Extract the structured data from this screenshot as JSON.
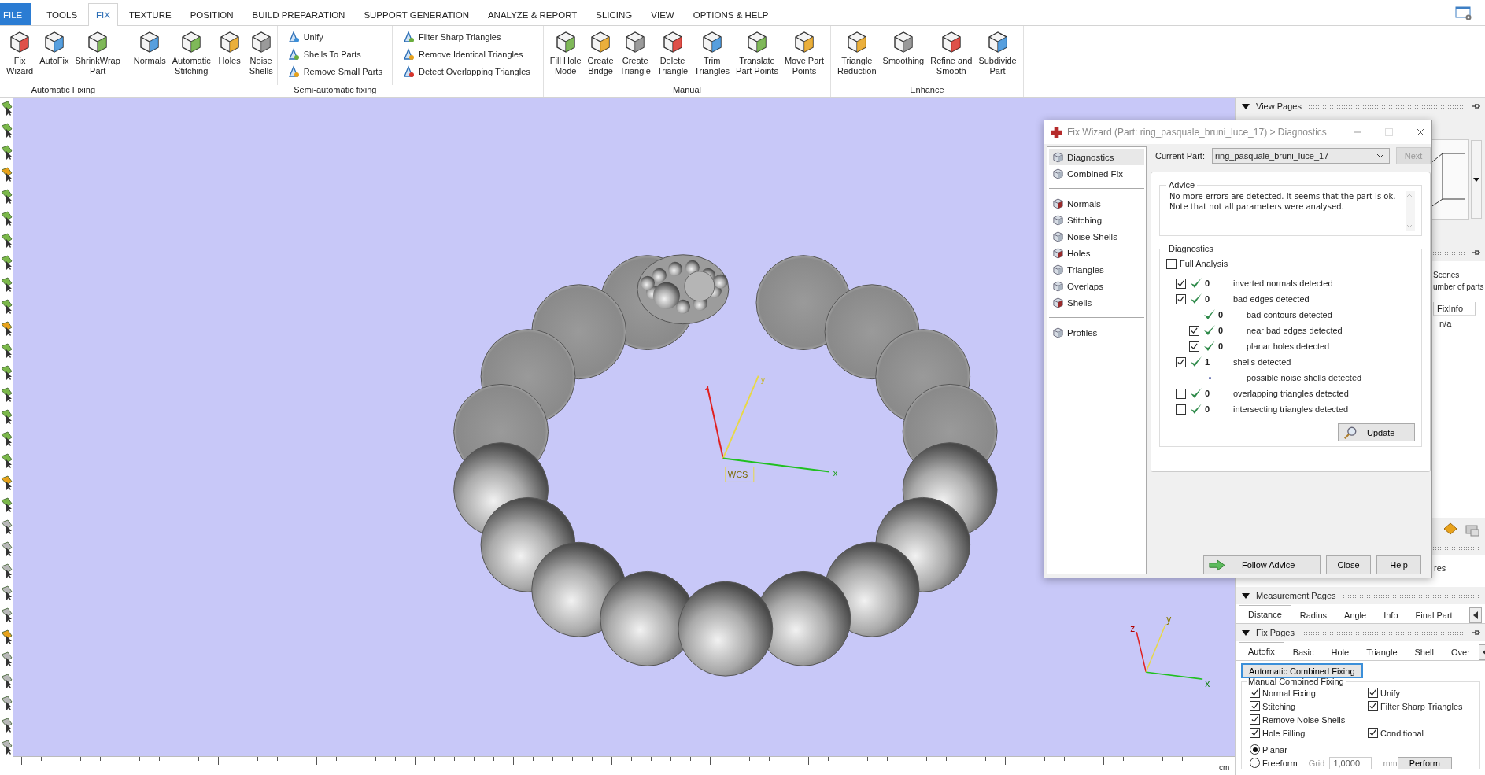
{
  "tabs": [
    {
      "label": "FILE",
      "kind": "file",
      "selected": false
    },
    {
      "label": "TOOLS",
      "kind": "tab",
      "selected": false
    },
    {
      "label": "FIX",
      "kind": "tab",
      "selected": true
    },
    {
      "label": "TEXTURE",
      "kind": "tab",
      "selected": false
    },
    {
      "label": "POSITION",
      "kind": "tab",
      "selected": false
    },
    {
      "label": "BUILD PREPARATION",
      "kind": "tab",
      "selected": false
    },
    {
      "label": "SUPPORT GENERATION",
      "kind": "tab",
      "selected": false
    },
    {
      "label": "ANALYZE & REPORT",
      "kind": "tab",
      "selected": false
    },
    {
      "label": "SLICING",
      "kind": "tab",
      "selected": false
    },
    {
      "label": "VIEW",
      "kind": "tab",
      "selected": false
    },
    {
      "label": "OPTIONS & HELP",
      "kind": "tab",
      "selected": false
    }
  ],
  "ribbon": {
    "groups": [
      {
        "label": "Automatic Fixing",
        "sections": [
          {
            "kind": "large",
            "items": [
              "Fix\nWizard",
              "AutoFix",
              "ShrinkWrap\nPart"
            ]
          }
        ]
      },
      {
        "label": "Semi-automatic fixing",
        "sections": [
          {
            "kind": "large",
            "items": [
              "Normals",
              "Automatic\nStitching",
              "Holes",
              "Noise\nShells"
            ]
          },
          {
            "kind": "small",
            "items": [
              "Unify",
              "Shells To Parts",
              "Remove Small Parts"
            ]
          },
          {
            "kind": "small",
            "items": [
              "Filter Sharp Triangles",
              "Remove Identical Triangles",
              "Detect Overlapping Triangles"
            ]
          }
        ]
      },
      {
        "label": "Manual",
        "sections": [
          {
            "kind": "large",
            "items": [
              "Fill Hole\nMode",
              "Create\nBridge",
              "Create\nTriangle",
              "Delete\nTriangle",
              "Trim\nTriangles",
              "Translate\nPart Points",
              "Move Part\nPoints"
            ]
          }
        ]
      },
      {
        "label": "Enhance",
        "sections": [
          {
            "kind": "large",
            "items": [
              "Triangle\nReduction",
              "Smoothing",
              "Refine and\nSmooth",
              "Subdivide\nPart"
            ]
          }
        ]
      }
    ]
  },
  "viewport": {
    "axes": {
      "z": "z",
      "y": "y",
      "x": "x",
      "origin": "WCS"
    },
    "mini_axes": {
      "z": "z",
      "y": "y",
      "x": "x"
    },
    "ruler_unit": "cm"
  },
  "dialog": {
    "title": "Fix Wizard (Part: ring_pasquale_bruni_luce_17) > Diagnostics",
    "nav_groups": [
      [
        {
          "label": "Diagnostics",
          "selected": true
        },
        {
          "label": "Combined Fix",
          "selected": false
        }
      ],
      [
        {
          "label": "Normals",
          "selected": false
        },
        {
          "label": "Stitching",
          "selected": false
        },
        {
          "label": "Noise Shells",
          "selected": false
        },
        {
          "label": "Holes",
          "selected": false
        },
        {
          "label": "Triangles",
          "selected": false
        },
        {
          "label": "Overlaps",
          "selected": false
        },
        {
          "label": "Shells",
          "selected": false
        }
      ],
      [
        {
          "label": "Profiles",
          "selected": false
        }
      ]
    ],
    "current_part": {
      "label": "Current Part:",
      "value": "ring_pasquale_bruni_luce_17"
    },
    "next": {
      "label": "Next",
      "disabled": true
    },
    "advice": {
      "title": "Advice",
      "lines": [
        "No more errors are detected. It seems that the part is ok.",
        "Note that not all parameters were analysed."
      ]
    },
    "diagnostics": {
      "title": "Diagnostics",
      "full_analysis": {
        "label": "Full Analysis",
        "checked": false
      },
      "rows": [
        {
          "kind": "check",
          "checked": true,
          "passed": true,
          "count": "0",
          "label": "inverted normals detected"
        },
        {
          "kind": "check",
          "checked": true,
          "passed": true,
          "count": "0",
          "label": "bad edges detected",
          "children": [
            {
              "kind": "plain",
              "passed": true,
              "count": "0",
              "label": "bad contours detected"
            },
            {
              "kind": "check",
              "checked": true,
              "passed": true,
              "count": "0",
              "label": "near bad edges detected"
            },
            {
              "kind": "check",
              "checked": true,
              "passed": true,
              "count": "0",
              "label": "planar holes detected"
            }
          ]
        },
        {
          "kind": "check",
          "checked": true,
          "passed": true,
          "count": "1",
          "label": "shells detected",
          "children": [
            {
              "kind": "plain",
              "passed": false,
              "label": "possible noise shells detected"
            }
          ]
        },
        {
          "kind": "check",
          "checked": false,
          "passed": true,
          "count": "0",
          "label": "overlapping triangles detected"
        },
        {
          "kind": "check",
          "checked": false,
          "passed": true,
          "count": "0",
          "label": "intersecting triangles detected"
        }
      ],
      "update": "Update"
    },
    "buttons": [
      "Follow Advice",
      "Close",
      "Help"
    ]
  },
  "panel": {
    "view_pages": "View Pages",
    "scenes": {
      "lines": [
        "Scenes",
        "umber of parts"
      ],
      "column": "FixInfo",
      "value": "n/a"
    },
    "res": "res",
    "measurement_pages": {
      "title": "Measurement Pages",
      "tabs": [
        {
          "label": "Distance",
          "selected": true
        },
        {
          "label": "Radius",
          "selected": false
        },
        {
          "label": "Angle",
          "selected": false
        },
        {
          "label": "Info",
          "selected": false
        },
        {
          "label": "Final Part",
          "selected": false
        }
      ]
    },
    "fix_pages": {
      "title": "Fix Pages",
      "tabs": [
        {
          "label": "Autofix",
          "selected": true
        },
        {
          "label": "Basic",
          "selected": false
        },
        {
          "label": "Hole",
          "selected": false
        },
        {
          "label": "Triangle",
          "selected": false
        },
        {
          "label": "Shell",
          "selected": false
        },
        {
          "label": "Over",
          "selected": false
        }
      ],
      "button": "Automatic Combined Fixing",
      "group": "Manual Combined Fixing",
      "options": [
        [
          {
            "label": "Normal Fixing",
            "checked": true
          },
          {
            "label": "Unify",
            "checked": true
          }
        ],
        [
          {
            "label": "Stitching",
            "checked": true
          },
          {
            "label": "Filter Sharp Triangles",
            "checked": true
          }
        ],
        [
          {
            "label": "Remove Noise Shells",
            "checked": true
          }
        ],
        [
          {
            "label": "Hole Filling",
            "checked": true
          },
          {
            "label": "Conditional",
            "checked": true
          }
        ]
      ],
      "radios": [
        {
          "label": "Planar",
          "selected": true
        },
        {
          "label": "Freeform",
          "selected": false
        }
      ],
      "grid": {
        "label": "Grid",
        "value": "1,0000",
        "unit": "mm"
      },
      "perform": "Perform"
    }
  }
}
